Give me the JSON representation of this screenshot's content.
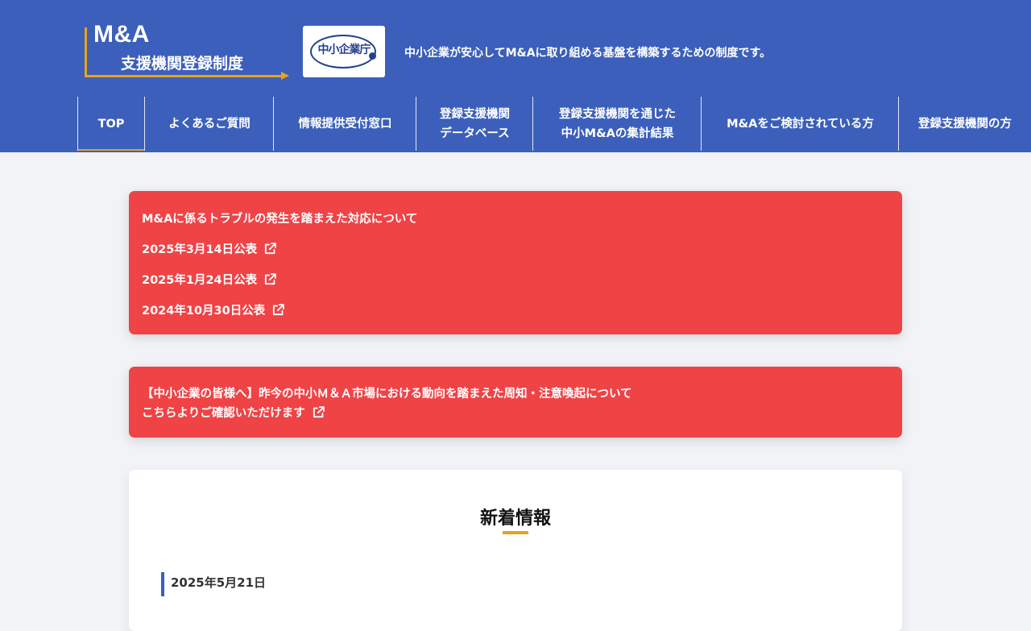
{
  "header": {
    "logo_main": "M&A",
    "logo_sub": "支援機関登録制度",
    "agency_logo_text": "中小企業庁",
    "tagline": "中小企業が安心してM&Aに取り組める基盤を構築するための制度です。"
  },
  "nav": {
    "items": [
      {
        "line1": "TOP",
        "line2": ""
      },
      {
        "line1": "よくあるご質問",
        "line2": ""
      },
      {
        "line1": "情報提供受付窓口",
        "line2": ""
      },
      {
        "line1": "登録支援機関",
        "line2": "データベース"
      },
      {
        "line1": "登録支援機関を通じた",
        "line2": "中小M&Aの集計結果"
      },
      {
        "line1": "M&Aをご検討されている方",
        "line2": ""
      },
      {
        "line1": "登録支援機関の方",
        "line2": ""
      }
    ],
    "active_index": 0
  },
  "notice1": {
    "title": "M&Aに係るトラブルの発生を踏まえた対応について",
    "links": [
      "2025年3月14日公表",
      "2025年1月24日公表",
      "2024年10月30日公表"
    ]
  },
  "notice2": {
    "line1": "【中小企業の皆様へ】昨今の中小Ｍ＆Ａ市場における動向を踏まえた周知・注意喚起について",
    "line2": "こちらよりご確認いただけます"
  },
  "news": {
    "title": "新着情報",
    "first_date": "2025年5月21日"
  },
  "colors": {
    "header_bg": "#3b5fba",
    "accent": "#e8a21b",
    "notice_bg": "#ef4346",
    "page_bg": "#f1f3f6"
  }
}
